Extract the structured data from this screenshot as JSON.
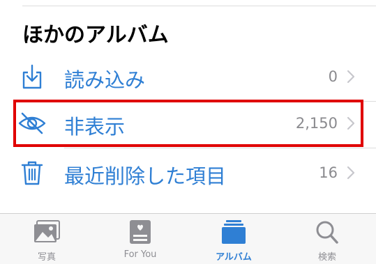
{
  "section": {
    "title": "ほかのアルバム"
  },
  "rows": [
    {
      "label": "読み込み",
      "count": "0",
      "icon": "import-icon"
    },
    {
      "label": "非表示",
      "count": "2,150",
      "icon": "hidden-eye-icon"
    },
    {
      "label": "最近削除した項目",
      "count": "16",
      "icon": "trash-icon"
    }
  ],
  "tabs": [
    {
      "label": "写真",
      "icon": "photos-icon"
    },
    {
      "label": "For You",
      "icon": "for-you-icon"
    },
    {
      "label": "アルバム",
      "icon": "albums-icon",
      "active": true
    },
    {
      "label": "検索",
      "icon": "search-icon"
    }
  ],
  "colors": {
    "accent": "#2f7fd4",
    "secondary_text": "#8a8a8e",
    "highlight_border": "#e00000",
    "tab_inactive": "#8e8e93"
  }
}
